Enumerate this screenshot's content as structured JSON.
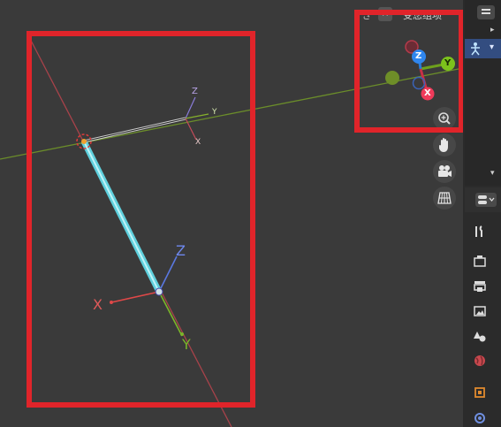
{
  "header": {
    "count_label": "ぎ",
    "close_label": "×",
    "overlay_label": "受您组项",
    "dropdown_icon": "chevron-down-icon"
  },
  "gizmo": {
    "z_label": "Z",
    "y_label": "Y",
    "x_label": "X"
  },
  "small_axes": {
    "z_label": "Z",
    "y_label": "Y",
    "x_label": "X"
  },
  "large_axes": {
    "z_label": "Z",
    "y_label": "Y",
    "x_label": "X"
  },
  "nav_buttons": [
    {
      "name": "zoom-icon",
      "glyph": "⊕"
    },
    {
      "name": "pan-hand-icon",
      "glyph": "✋"
    },
    {
      "name": "camera-icon",
      "glyph": "🎥"
    },
    {
      "name": "grid-icon",
      "glyph": "▦"
    }
  ],
  "outliner": {
    "expand_glyph": "▸",
    "collapse_glyph": "▾"
  },
  "props": {
    "toggle_glyph": "⊟"
  },
  "colors": {
    "x_axis": "#ff3352",
    "y_axis": "#8bdc00",
    "z_axis": "#2890ff",
    "selection": "#55d6e6",
    "highlight_box": "#e0242a"
  }
}
